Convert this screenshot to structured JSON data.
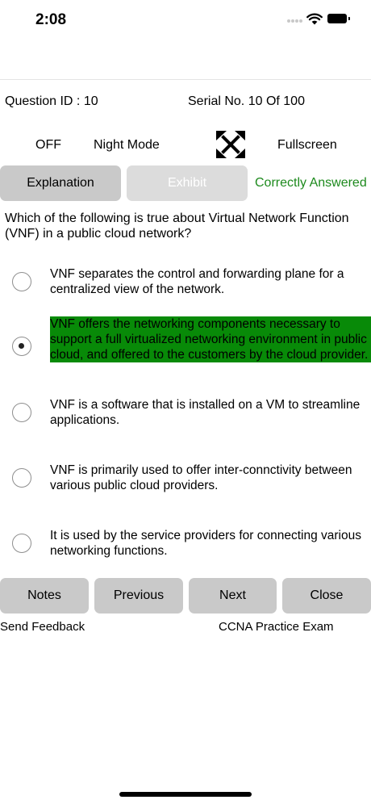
{
  "status_bar": {
    "time": "2:08"
  },
  "info": {
    "question_id": "Question ID : 10",
    "serial": "Serial No. 10 Of 100",
    "night_mode_state": "OFF",
    "night_mode_label": "Night Mode",
    "fullscreen_label": "Fullscreen",
    "fullscreen_icon": "expand-arrows-icon"
  },
  "actions": {
    "explanation": "Explanation",
    "exhibit": "Exhibit",
    "answer_status": "Correctly Answered",
    "answer_status_color": "#1d8a1d"
  },
  "question": "Which of the following is true about Virtual Network Function (VNF) in a public cloud network?",
  "options": [
    {
      "text": "VNF separates the control and forwarding plane for a centralized view of the network.",
      "selected": false
    },
    {
      "text": "VNF offers the networking components necessary to support a full virtualized networking environment in public cloud, and offered to the customers by the cloud provider.",
      "selected": true,
      "highlight_color": "#088a08"
    },
    {
      "text": "VNF is a software that is installed on a VM to streamline applications.",
      "selected": false
    },
    {
      "text": "VNF is primarily used to offer inter-connctivity between various public cloud providers.",
      "selected": false
    },
    {
      "text": "It is used by the service providers for connecting various networking functions.",
      "selected": false
    }
  ],
  "nav": {
    "notes": "Notes",
    "previous": "Previous",
    "next": "Next",
    "close": "Close"
  },
  "footer": {
    "feedback": "Send Feedback",
    "app_name": "CCNA Practice Exam"
  }
}
